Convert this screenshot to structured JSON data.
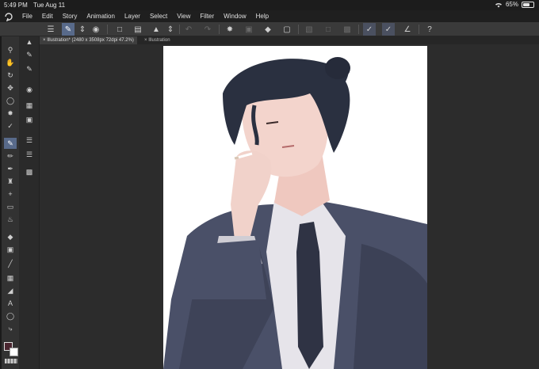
{
  "status": {
    "time": "5:49 PM",
    "date": "Tue Aug 11",
    "battery_text": "65%",
    "battery_level": 0.65
  },
  "menu": {
    "items": [
      "File",
      "Edit",
      "Story",
      "Animation",
      "Layer",
      "Select",
      "View",
      "Filter",
      "Window",
      "Help"
    ]
  },
  "tabs": [
    {
      "label": "Illustration* (2480 x 3508px 72dpi 47.2%)",
      "active": true
    },
    {
      "label": "Illustration",
      "active": false
    }
  ],
  "colors": {
    "main": "#4a2630",
    "sub": "#ffffff",
    "accent": "#586a8a"
  },
  "icons": {
    "command_bar": [
      "menu-icon",
      "pen-icon",
      "chevron-updown-icon",
      "layer-icon",
      "new-file-icon",
      "open-folder-icon",
      "save-icon",
      "chevron-updown-icon",
      "undo-icon",
      "redo-icon",
      "transform-icon",
      "select-all-icon",
      "fill-icon",
      "crop-icon",
      "clear-icon",
      "border-icon",
      "layer-mask-icon",
      "pen-check-icon",
      "brush-check-icon",
      "pen-edit-icon",
      "help-icon"
    ],
    "tools": [
      "zoom-icon",
      "hand-icon",
      "rotate-icon",
      "move-icon",
      "lasso-icon",
      "magic-wand-icon",
      "eyedropper-icon",
      "pen-icon",
      "pencil-icon",
      "brush-icon",
      "airbrush-icon",
      "decoration-icon",
      "eraser-icon",
      "blend-icon",
      "fill-icon",
      "gradient-icon",
      "figure-icon",
      "frame-icon",
      "ruler-icon",
      "text-icon",
      "balloon-icon",
      "correction-icon"
    ]
  }
}
